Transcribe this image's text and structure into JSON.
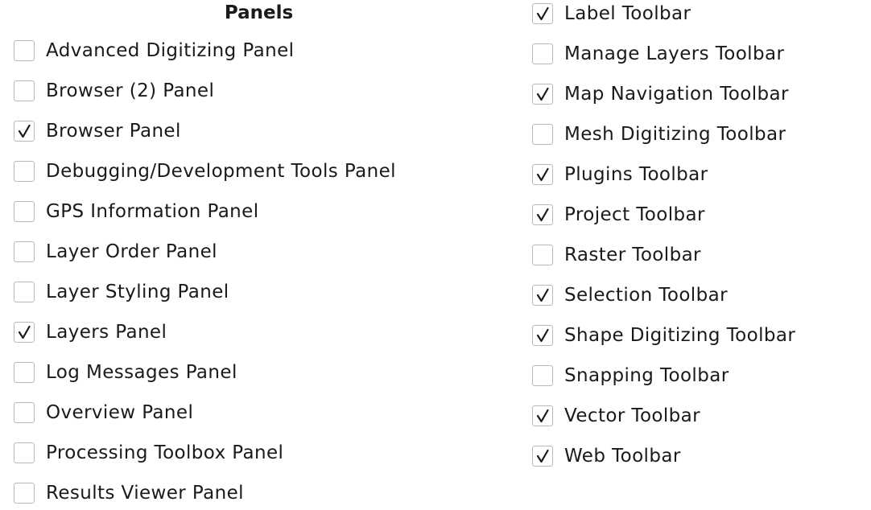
{
  "panels": {
    "heading": "Panels",
    "items": [
      {
        "label": "Advanced Digitizing Panel",
        "checked": false
      },
      {
        "label": "Browser (2) Panel",
        "checked": false
      },
      {
        "label": "Browser Panel",
        "checked": true
      },
      {
        "label": "Debugging/Development Tools Panel",
        "checked": false
      },
      {
        "label": "GPS Information Panel",
        "checked": false
      },
      {
        "label": "Layer Order Panel",
        "checked": false
      },
      {
        "label": "Layer Styling Panel",
        "checked": false
      },
      {
        "label": "Layers Panel",
        "checked": true
      },
      {
        "label": "Log Messages Panel",
        "checked": false
      },
      {
        "label": "Overview Panel",
        "checked": false
      },
      {
        "label": "Processing Toolbox Panel",
        "checked": false
      },
      {
        "label": "Results Viewer Panel",
        "checked": false
      }
    ]
  },
  "toolbars": {
    "items": [
      {
        "label": "Label Toolbar",
        "checked": true
      },
      {
        "label": "Manage Layers Toolbar",
        "checked": false
      },
      {
        "label": "Map Navigation Toolbar",
        "checked": true
      },
      {
        "label": "Mesh Digitizing Toolbar",
        "checked": false
      },
      {
        "label": "Plugins Toolbar",
        "checked": true
      },
      {
        "label": "Project Toolbar",
        "checked": true
      },
      {
        "label": "Raster Toolbar",
        "checked": false
      },
      {
        "label": "Selection Toolbar",
        "checked": true
      },
      {
        "label": "Shape Digitizing Toolbar",
        "checked": true
      },
      {
        "label": "Snapping Toolbar",
        "checked": false
      },
      {
        "label": "Vector Toolbar",
        "checked": true
      },
      {
        "label": "Web Toolbar",
        "checked": true
      }
    ]
  },
  "colors": {
    "checkbox_border": "#b8b8b8",
    "checkmark": "#1a1a1a",
    "text": "#1a1a1a",
    "background": "#ffffff"
  },
  "icons": {
    "checkmark": "checkmark-icon"
  }
}
